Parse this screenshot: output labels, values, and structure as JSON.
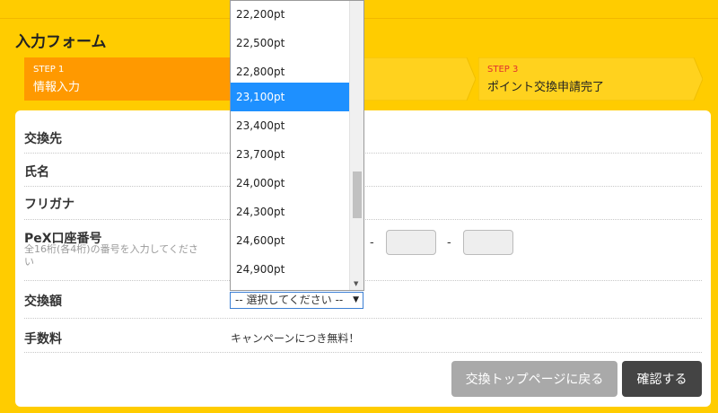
{
  "page_title": "入力フォーム",
  "steps": [
    {
      "no": "STEP 1",
      "name": "情報入力"
    },
    {
      "no": "",
      "name": ""
    },
    {
      "no": "STEP 3",
      "name": "ポイント交換申請完了"
    }
  ],
  "form": {
    "exchange_to_label": "交換先",
    "name_label": "氏名",
    "furigana_label": "フリガナ",
    "pex_label": "PeX口座番号",
    "pex_hint": "全16桁(各4桁)の番号を入力してください",
    "pex_separator": "-",
    "amount_label": "交換額",
    "amount_select_value": "-- 選択してください --",
    "fee_label": "手数料",
    "fee_value": "キャンペーンにつき無料！"
  },
  "dropdown": {
    "options": [
      "22,200pt",
      "22,500pt",
      "22,800pt",
      "23,100pt",
      "23,400pt",
      "23,700pt",
      "24,000pt",
      "24,300pt",
      "24,600pt",
      "24,900pt"
    ],
    "highlighted": "23,100pt"
  },
  "buttons": {
    "back": "交換トップページに戻る",
    "confirm": "確認する"
  },
  "colors": {
    "background": "#ffcc00",
    "step_active": "#ff9900",
    "step_inactive": "#ffd21e",
    "option_highlight": "#1e90ff",
    "back_button": "#a9a9a9",
    "confirm_button": "#444444"
  }
}
